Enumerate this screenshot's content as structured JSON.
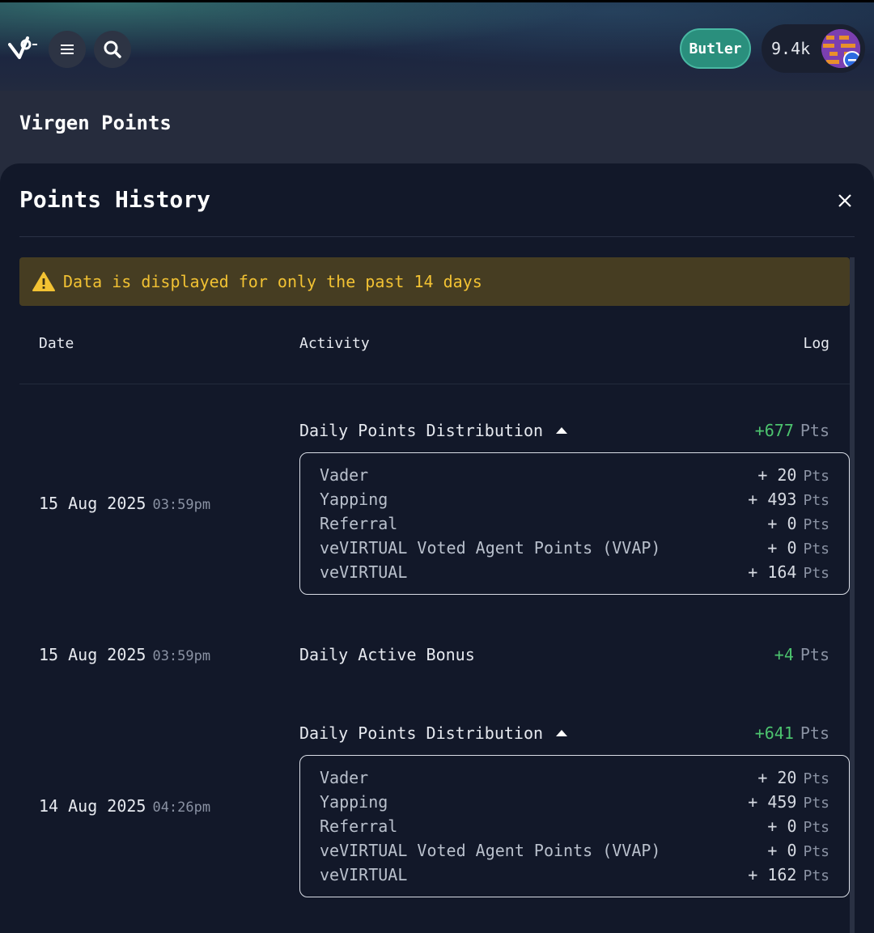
{
  "header": {
    "butler_label": "Butler",
    "points_value": "9.4k"
  },
  "subheader": {
    "title": "Virgen Points"
  },
  "panel": {
    "title": "Points History",
    "warning": "Data is displayed for only the past 14 days",
    "columns": {
      "date": "Date",
      "activity": "Activity",
      "log": "Log"
    }
  },
  "entries": [
    {
      "date": "15 Aug 2025",
      "time": "03:59pm",
      "activity": "Daily Points Distribution",
      "log": "+677",
      "unit": "Pts",
      "details": [
        {
          "name": "Vader",
          "amount": "+ 20",
          "unit": "Pts"
        },
        {
          "name": "Yapping",
          "amount": "+ 493",
          "unit": "Pts"
        },
        {
          "name": "Referral",
          "amount": "+ 0",
          "unit": "Pts"
        },
        {
          "name": "veVIRTUAL Voted Agent Points (VVAP)",
          "amount": "+ 0",
          "unit": "Pts"
        },
        {
          "name": "veVIRTUAL",
          "amount": "+ 164",
          "unit": "Pts"
        }
      ]
    },
    {
      "date": "15 Aug 2025",
      "time": "03:59pm",
      "activity": "Daily Active Bonus",
      "log": "+4",
      "unit": "Pts"
    },
    {
      "date": "14 Aug 2025",
      "time": "04:26pm",
      "activity": "Daily Points Distribution",
      "log": "+641",
      "unit": "Pts",
      "details": [
        {
          "name": "Vader",
          "amount": "+ 20",
          "unit": "Pts"
        },
        {
          "name": "Yapping",
          "amount": "+ 459",
          "unit": "Pts"
        },
        {
          "name": "Referral",
          "amount": "+ 0",
          "unit": "Pts"
        },
        {
          "name": "veVIRTUAL Voted Agent Points (VVAP)",
          "amount": "+ 0",
          "unit": "Pts"
        },
        {
          "name": "veVIRTUAL",
          "amount": "+ 162",
          "unit": "Pts"
        }
      ]
    }
  ],
  "icons": {
    "logo": "virgen-logo-icon",
    "menu": "hamburger-menu-icon",
    "search": "search-icon",
    "close": "close-icon",
    "warning": "warning-icon",
    "caret": "caret-up-icon"
  },
  "colors": {
    "accent_green": "#4cc36e",
    "butler_bg": "#2a8f7d",
    "warning_text": "#f2c233",
    "warning_bg": "#463d22"
  }
}
